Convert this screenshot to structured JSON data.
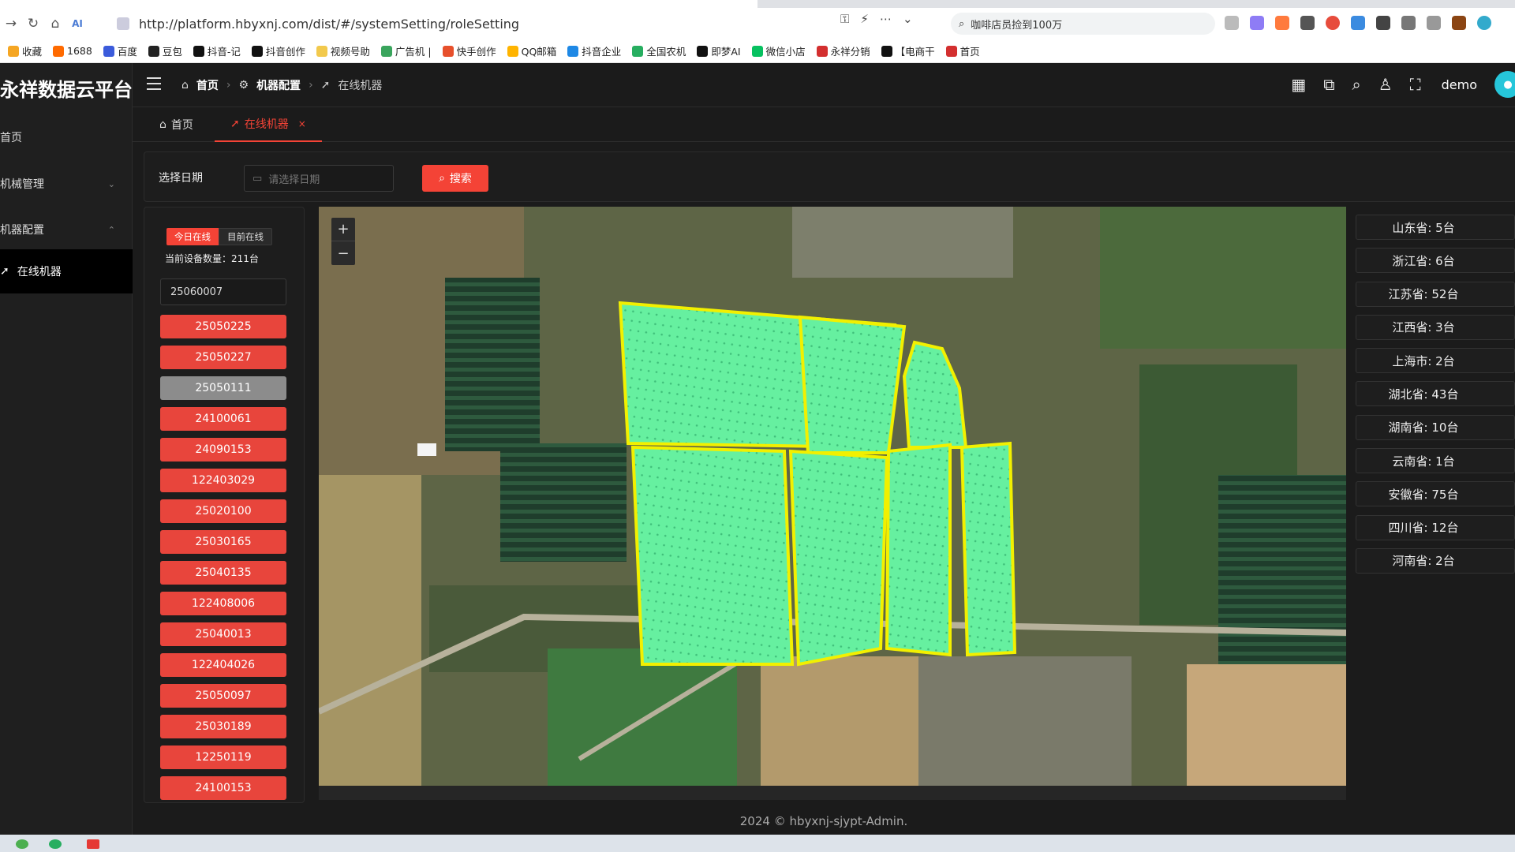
{
  "browser": {
    "url": "http://platform.hbyxnj.com/dist/#/systemSetting/roleSetting",
    "search_text": "咖啡店员捡到100万",
    "bookmarks": [
      "收藏",
      "1688",
      "百度",
      "豆包",
      "抖音-记",
      "抖音创作",
      "视频号助",
      "广告机 |",
      "快手创作",
      "QQ邮箱",
      "抖音企业",
      "全国农机",
      "即梦AI",
      "微信小店",
      "永祥分销",
      "【电商干",
      "首页"
    ]
  },
  "app": {
    "logo": "永祥数据云平台",
    "user": "demo",
    "footer": "2024 © hbyxnj-sjypt-Admin."
  },
  "sidebar": {
    "items": [
      {
        "label": "首页"
      },
      {
        "label": "机械管理"
      },
      {
        "label": "机器配置"
      },
      {
        "label": "在线机器"
      }
    ]
  },
  "breadcrumb": {
    "home": "首页",
    "config": "机器配置",
    "current": "在线机器"
  },
  "tabs": [
    {
      "label": "首页"
    },
    {
      "label": "在线机器"
    }
  ],
  "filter": {
    "label": "选择日期",
    "placeholder": "请选择日期",
    "search": "搜索"
  },
  "devices": {
    "seg_today": "今日在线",
    "seg_now": "目前在线",
    "count_text": "当前设备数量：211台",
    "input_value": "25060007",
    "list": [
      "25050225",
      "25050227",
      "25050111",
      "24100061",
      "24090153",
      "122403029",
      "25020100",
      "25030165",
      "25040135",
      "122408006",
      "25040013",
      "122404026",
      "25050097",
      "25030189",
      "12250119",
      "24100153"
    ],
    "selected": "25050111"
  },
  "map": {
    "zoom_in": "+",
    "zoom_out": "−"
  },
  "provinces": [
    "山东省: 5台",
    "浙江省: 6台",
    "江苏省: 52台",
    "江西省: 3台",
    "上海市: 2台",
    "湖北省: 43台",
    "湖南省: 10台",
    "云南省: 1台",
    "安徽省: 75台",
    "四川省: 12台",
    "河南省: 2台"
  ],
  "colors": {
    "accent": "#f44336",
    "track_fill": "#66f0a0",
    "track_border": "#f2f000"
  }
}
